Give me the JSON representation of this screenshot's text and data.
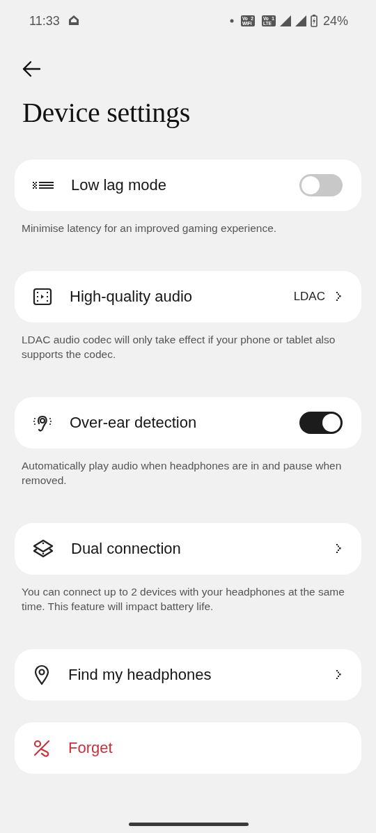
{
  "status_bar": {
    "time": "11:33",
    "indicators": [
      {
        "top": "Vo",
        "index": "2",
        "bottom": "WiFi"
      },
      {
        "top": "Vo",
        "index": "1",
        "bottom": "LTE"
      }
    ],
    "battery": "24%"
  },
  "title": "Device settings",
  "settings": [
    {
      "kind": "toggle",
      "label": "Low lag mode",
      "on": false,
      "description": "Minimise latency for an improved gaming experience."
    },
    {
      "kind": "value",
      "label": "High-quality audio",
      "value": "LDAC",
      "description": "LDAC audio codec will only take effect if your phone or tablet also supports the codec."
    },
    {
      "kind": "toggle",
      "label": "Over-ear detection",
      "on": true,
      "description": "Automatically play audio when headphones are in and pause when removed."
    },
    {
      "kind": "link",
      "label": "Dual connection",
      "description": "You can connect up to 2 devices with your headphones at the same time. This feature will impact battery life."
    },
    {
      "kind": "link",
      "label": "Find my headphones"
    },
    {
      "kind": "danger",
      "label": "Forget"
    }
  ]
}
